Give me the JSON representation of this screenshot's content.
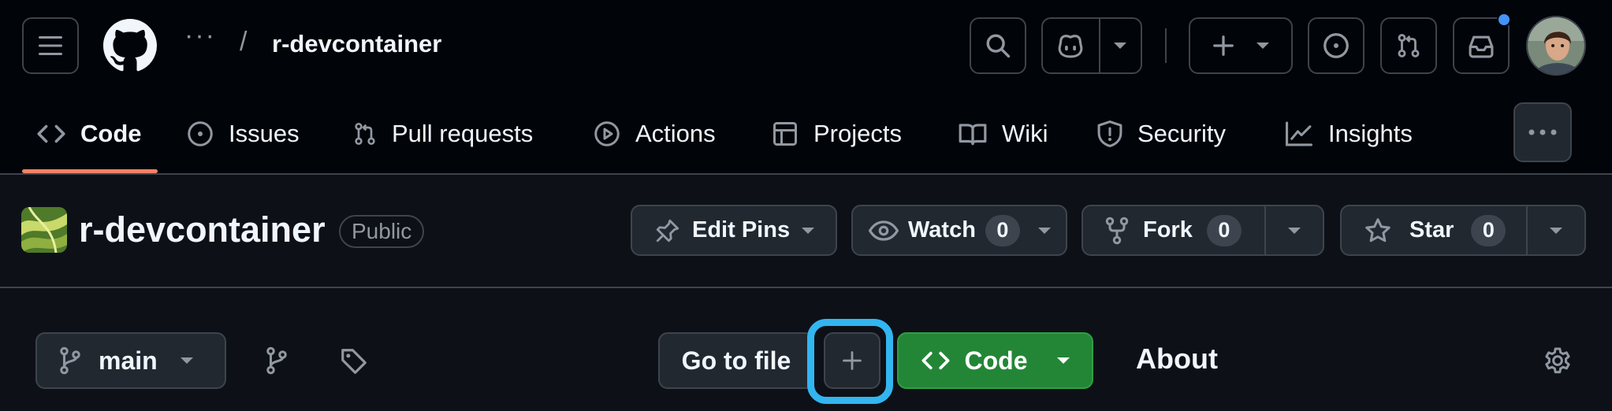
{
  "topbar": {
    "breadcrumb_dots": "···",
    "breadcrumb_sep": "/",
    "repo_name": "r-devcontainer"
  },
  "nav": {
    "tabs": [
      {
        "label": "Code",
        "icon": "code-icon",
        "active": true
      },
      {
        "label": "Issues",
        "icon": "issue-icon"
      },
      {
        "label": "Pull requests",
        "icon": "pull-request-icon"
      },
      {
        "label": "Actions",
        "icon": "play-icon"
      },
      {
        "label": "Projects",
        "icon": "table-icon"
      },
      {
        "label": "Wiki",
        "icon": "book-icon"
      },
      {
        "label": "Security",
        "icon": "shield-icon"
      },
      {
        "label": "Insights",
        "icon": "graph-icon"
      }
    ]
  },
  "repo_header": {
    "title": "r-devcontainer",
    "visibility": "Public",
    "edit_pins_label": "Edit Pins",
    "watch_label": "Watch",
    "watch_count": "0",
    "fork_label": "Fork",
    "fork_count": "0",
    "star_label": "Star",
    "star_count": "0"
  },
  "main": {
    "branch": "main",
    "go_to_file_label": "Go to file",
    "code_label": "Code",
    "about_heading": "About"
  },
  "colors": {
    "accent_underline": "#f78166",
    "code_button": "#238636",
    "highlight": "#33b5f0",
    "notification_dot": "#4493f8"
  }
}
